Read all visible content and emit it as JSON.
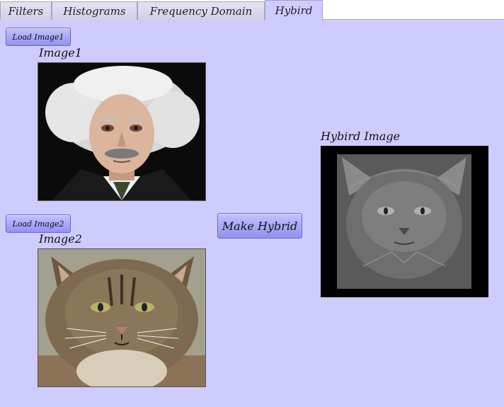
{
  "tabs": [
    {
      "label": "Filters"
    },
    {
      "label": "Histograms"
    },
    {
      "label": "Frequency Domain"
    },
    {
      "label": "Hybird",
      "active": true
    }
  ],
  "image1": {
    "load_button_label": "Load Image1",
    "title": "Image1",
    "picture": "einstein-portrait"
  },
  "image2": {
    "load_button_label": "Load Image2",
    "title": "Image2",
    "picture": "cat-photo"
  },
  "make_hybrid_label": "Make Hybrid",
  "hybrid": {
    "title": "Hybird Image",
    "picture": "hybrid-grayscale-cat"
  },
  "colors": {
    "background": "#ceccfc",
    "button": "#a9a7f7"
  }
}
